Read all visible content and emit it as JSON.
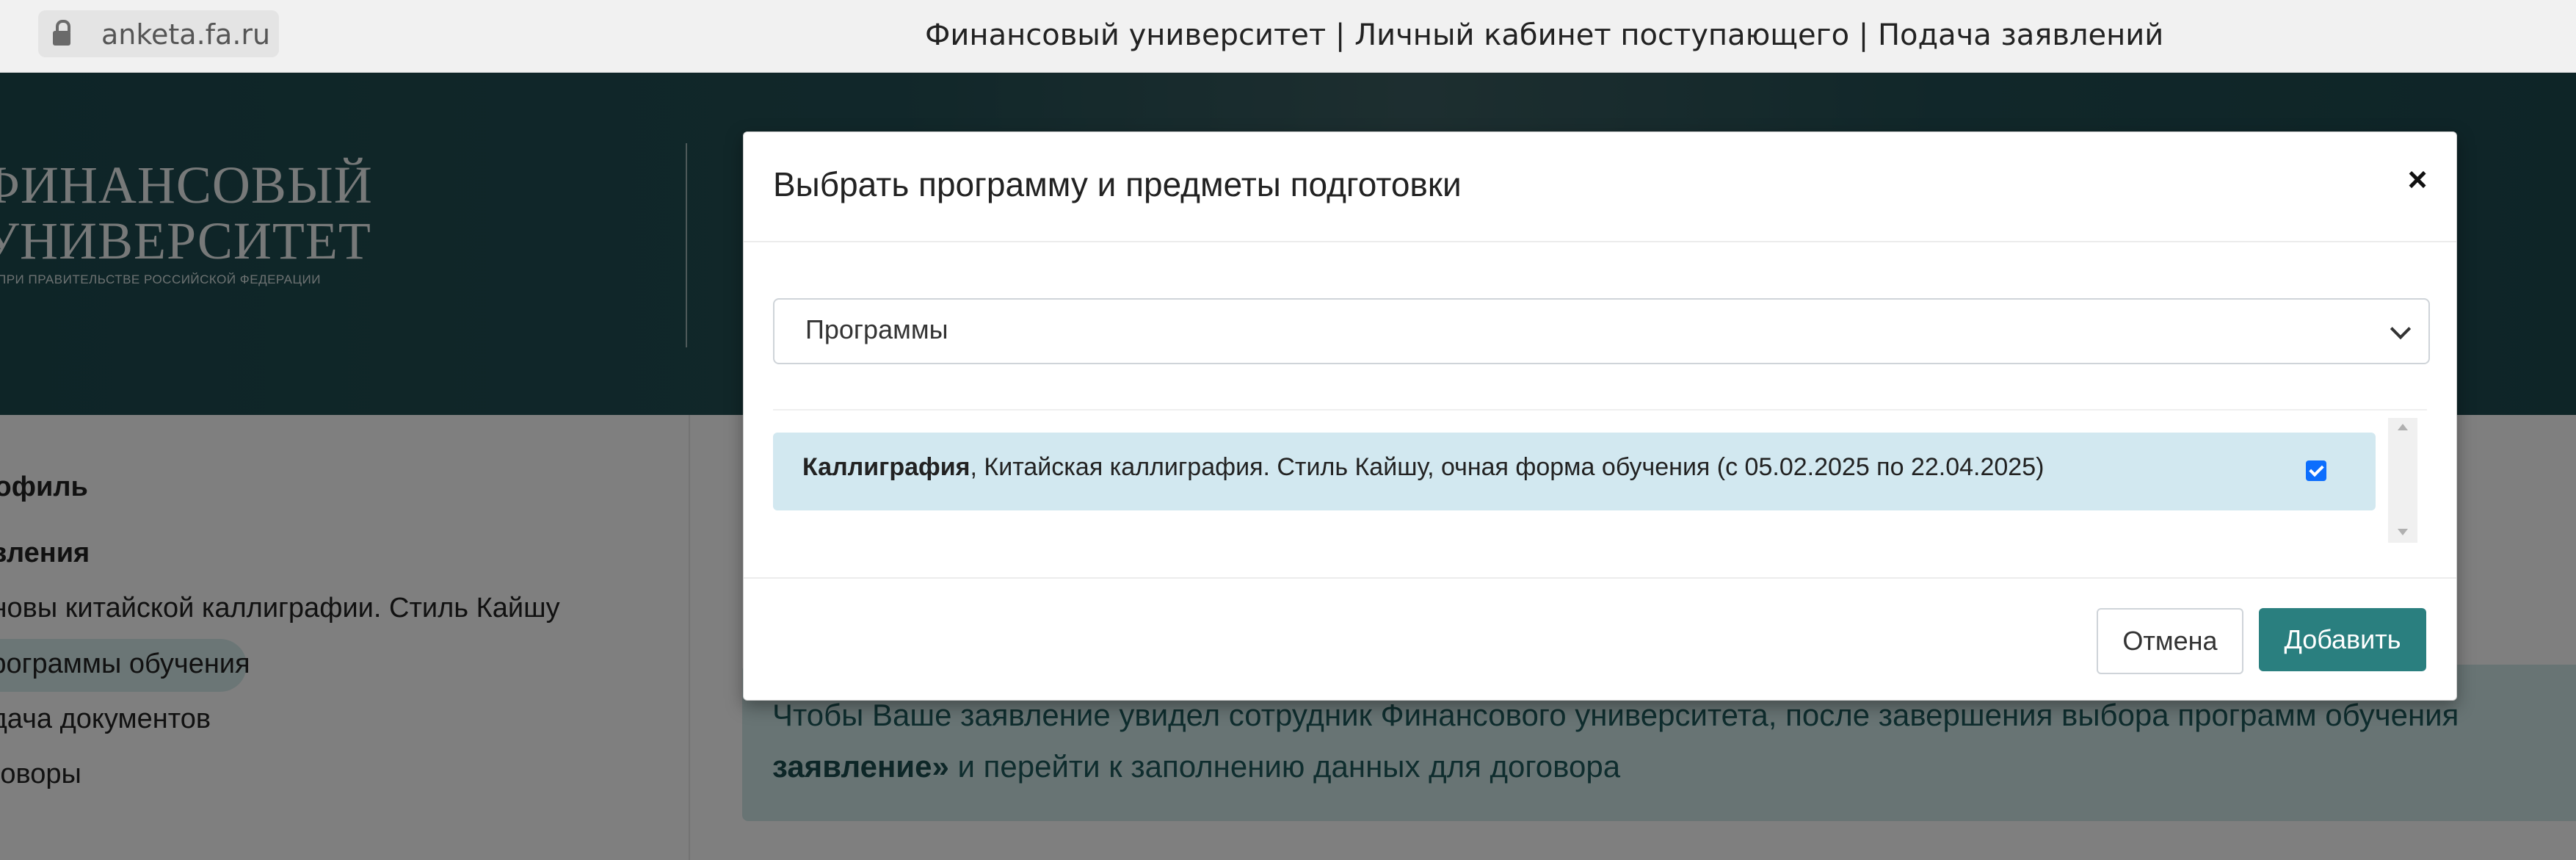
{
  "browser": {
    "url": "anketa.fa.ru",
    "title": "Финансовый университет | Личный кабинет поступающего | Подача заявлений"
  },
  "header": {
    "logo_line1": "ФИНАНСОВЫЙ",
    "logo_line2": "УНИВЕРСИТЕТ",
    "logo_sub": "ПРИ ПРАВИТЕЛЬСТВЕ РОССИЙСКОЙ ФЕДЕРАЦИИ"
  },
  "sidebar": {
    "items": [
      {
        "label": "Профиль"
      },
      {
        "label": "Заявления"
      },
      {
        "label": "Основы китайской каллиграфии. Стиль Кайшу"
      },
      {
        "label": "Программы обучения"
      },
      {
        "label": "Подача документов"
      },
      {
        "label": "Договоры"
      }
    ]
  },
  "info": {
    "line1": "Чтобы Ваше заявление увидел сотрудник Финансового университета, после завершения выбора программ обучения",
    "line2_bold": "заявление»",
    "line2_rest": "и перейти к заполнению данных для договора"
  },
  "modal": {
    "title": "Выбрать программу и предметы подготовки",
    "close_symbol": "×",
    "select_value": "Программы",
    "row": {
      "name": "Каллиграфия",
      "details": ", Китайская каллиграфия. Стиль Кайшу, очная форма обучения (с 05.02.2025 по 22.04.2025)",
      "checked": true
    },
    "cancel_label": "Отмена",
    "add_label": "Добавить"
  },
  "colors": {
    "header_bg": "#1d4a4f",
    "primary_button": "#2a7f7f",
    "selected_row": "#d2e8f0",
    "info_box": "#d0e8e8",
    "checkbox": "#0d6efd"
  }
}
